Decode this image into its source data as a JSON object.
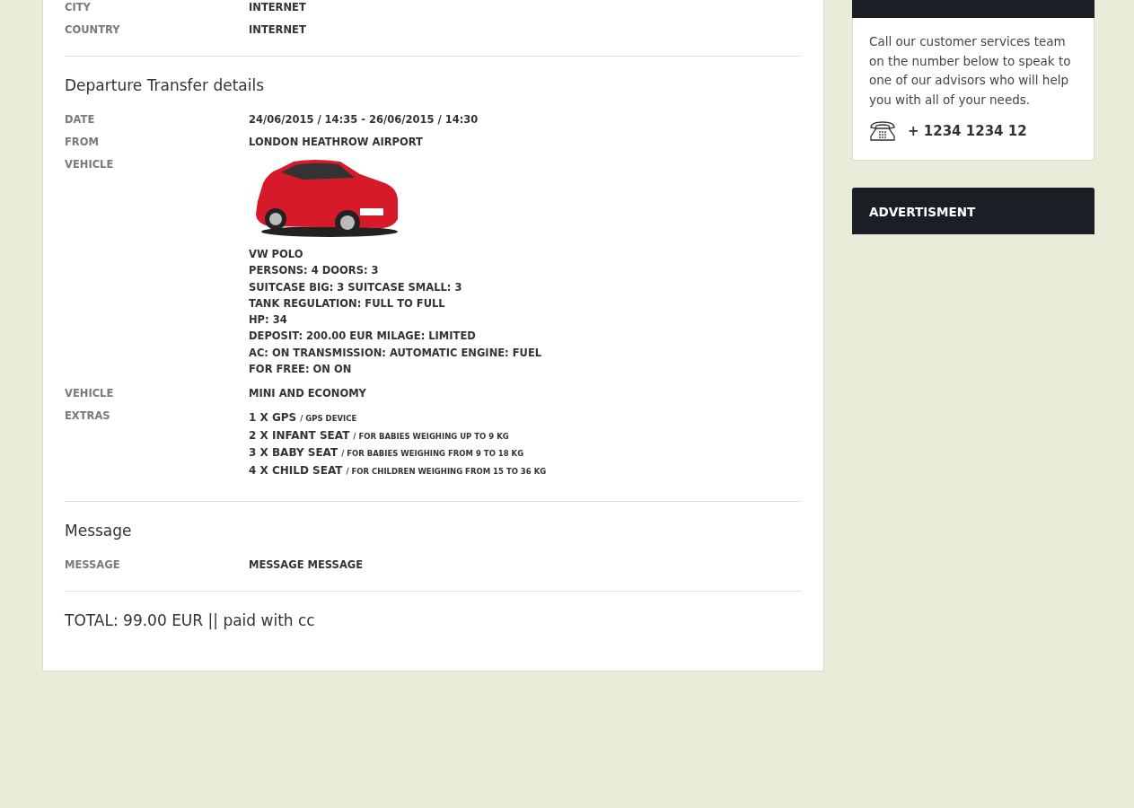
{
  "top_rows": [
    {
      "label": "CITY",
      "value": "INTERNET"
    },
    {
      "label": "COUNTRY",
      "value": "INTERNET"
    }
  ],
  "departure": {
    "title": "Departure Transfer details",
    "rows": [
      {
        "kind": "text",
        "label": "DATE",
        "value": "24/06/2015 / 14:35 - 26/06/2015 / 14:30"
      },
      {
        "kind": "text",
        "label": "FROM",
        "value": "LONDON HEATHROW AIRPORT"
      },
      {
        "kind": "vehicle",
        "label": "VEHICLE",
        "lines": [
          "VW POLO",
          "PERSONS: 4 DOORS: 3",
          "SUITCASE BIG: 3 SUITCASE SMALL: 3",
          "TANK REGULATION: FULL TO FULL",
          "HP: 34",
          "DEPOSIT: 200.00 EUR MILAGE: LIMITED",
          "AC: ON TRANSMISSION: AUTOMATIC ENGINE: FUEL",
          "FOR FREE: ON ON"
        ]
      },
      {
        "kind": "text",
        "label": "VEHICLE",
        "value": "MINI AND ECONOMY"
      },
      {
        "kind": "extras",
        "label": "EXTRAS",
        "items": [
          {
            "name": "1 X GPS",
            "note": "/ GPS DEVICE"
          },
          {
            "name": "2 X INFANT SEAT",
            "note": "/ FOR BABIES WEIGHING UP TO 9 KG"
          },
          {
            "name": "3 X BABY SEAT",
            "note": "/ FOR BABIES WEIGHING FROM 9 TO 18 KG"
          },
          {
            "name": "4 X CHILD SEAT",
            "note": "/ FOR CHILDREN WEIGHING FROM 15 TO 36 KG"
          }
        ]
      }
    ]
  },
  "message": {
    "title": "Message",
    "label": "MESSAGE",
    "value": "MESSAGE MESSAGE"
  },
  "total": "TOTAL: 99.00 EUR || paid with cc",
  "sidebar": {
    "help_text": "Call our customer services team on the number below to speak to one of our advisors who will help you with all of your needs.",
    "phone": "+ 1234 1234 12",
    "ad_title": "ADVERTISMENT"
  }
}
